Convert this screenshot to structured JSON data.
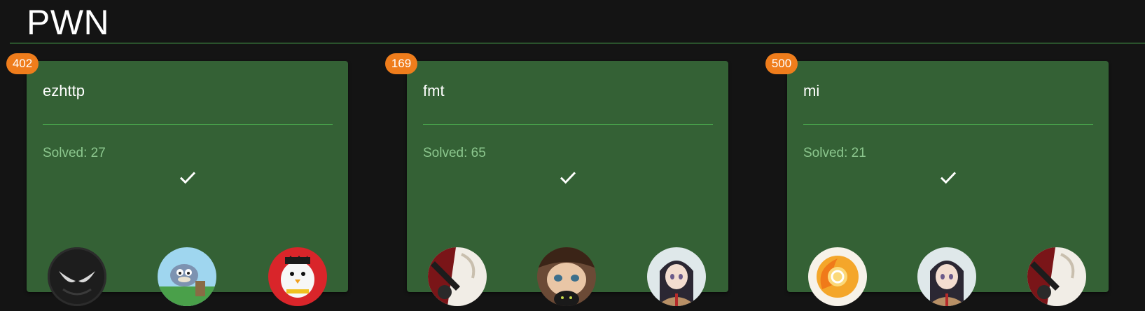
{
  "category": {
    "title": "PWN"
  },
  "challenges": [
    {
      "name": "ezhttp",
      "points": "402",
      "solved_label": "Solved: 27",
      "status_icon": "check-icon"
    },
    {
      "name": "fmt",
      "points": "169",
      "solved_label": "Solved: 65",
      "status_icon": "check-icon"
    },
    {
      "name": "mi",
      "points": "500",
      "solved_label": "Solved: 21",
      "status_icon": "check-icon"
    }
  ],
  "colors": {
    "background": "#141414",
    "card": "#346135",
    "accent_line": "#4caf50",
    "badge": "#ef7d1c",
    "solved_text": "#8cc78e"
  }
}
